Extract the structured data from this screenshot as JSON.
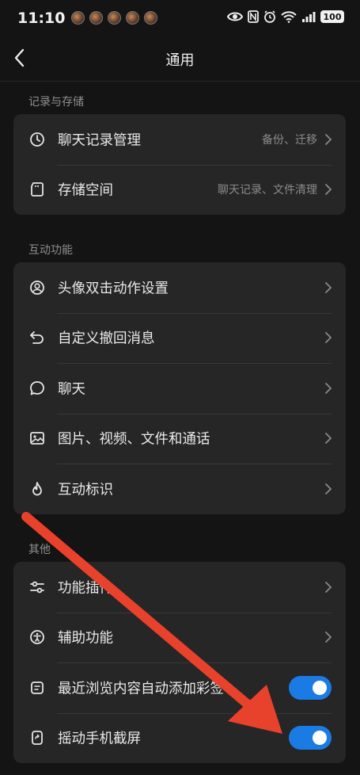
{
  "status_bar": {
    "time": "11:10",
    "battery": "100"
  },
  "header": {
    "title": "通用"
  },
  "sections": [
    {
      "label": "记录与存储",
      "items": [
        {
          "label": "聊天记录管理",
          "value": "备份、迁移",
          "icon": "clock-icon"
        },
        {
          "label": "存储空间",
          "value": "聊天记录、文件清理",
          "icon": "sd-card-icon"
        }
      ]
    },
    {
      "label": "互动功能",
      "items": [
        {
          "label": "头像双击动作设置",
          "icon": "user-circle-icon"
        },
        {
          "label": "自定义撤回消息",
          "icon": "undo-icon"
        },
        {
          "label": "聊天",
          "icon": "chat-bubble-icon"
        },
        {
          "label": "图片、视频、文件和通话",
          "icon": "image-icon"
        },
        {
          "label": "互动标识",
          "icon": "flame-icon"
        }
      ]
    },
    {
      "label": "其他",
      "items": [
        {
          "label": "功能插件",
          "icon": "sliders-icon"
        },
        {
          "label": "辅助功能",
          "icon": "accessibility-icon"
        },
        {
          "label": "最近浏览内容自动添加彩签",
          "icon": "note-icon",
          "toggle": true
        },
        {
          "label": "摇动手机截屏",
          "icon": "shake-screenshot-icon",
          "toggle": true
        }
      ]
    }
  ],
  "colors": {
    "accent": "#1a7be4",
    "annotation_arrow": "#e8412c",
    "card": "#262626",
    "background": "#141414"
  }
}
